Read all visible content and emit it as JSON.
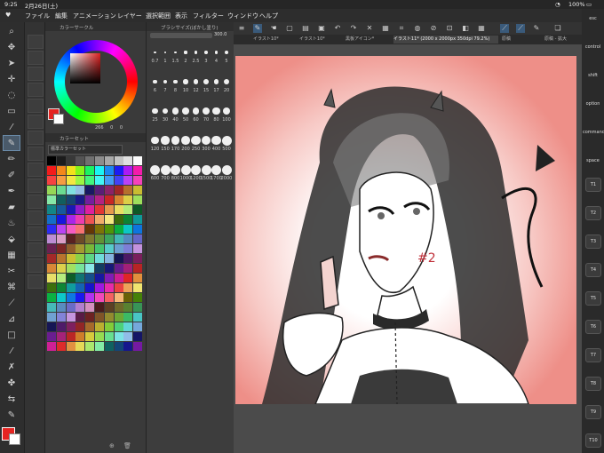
{
  "status": {
    "time": "9:25",
    "date": "2月26日(土)",
    "battery": "100%"
  },
  "menu": [
    "ファイル",
    "編集",
    "アニメーション",
    "レイヤー",
    "選択範囲",
    "表示",
    "フィルター",
    "ウィンドウ",
    "ヘルプ"
  ],
  "panels": {
    "color_circle": "カラーサークル",
    "brush_size": "ブラシサイズ(ぼかし塗り)",
    "brush_value": "300.0",
    "color_set": "カラーセット",
    "color_set_name": "標準カラーセット",
    "hsv": [
      "266",
      "0",
      "0"
    ]
  },
  "brush_sizes": [
    "0.7",
    "1",
    "1.5",
    "2",
    "2.5",
    "3",
    "4",
    "5",
    "6",
    "7",
    "8",
    "10",
    "12",
    "15",
    "17",
    "20",
    "25",
    "30",
    "40",
    "50",
    "60",
    "70",
    "80",
    "100",
    "120",
    "150",
    "170",
    "200",
    "250",
    "300",
    "400",
    "500",
    "600",
    "700",
    "800",
    "1000",
    "1200",
    "1500",
    "1700",
    "2000"
  ],
  "tabs": [
    "イラスト10*",
    "イラスト10*",
    "黒板アイコン*",
    "イラスト11* (2000 x 2000px 350dpi 79.2%)",
    "原稿",
    "原稿 - 拡大"
  ],
  "right_keys": {
    "esc": "esc",
    "control": "control",
    "shift": "shift",
    "option": "option",
    "command": "command",
    "space": "space"
  },
  "tkeys": [
    "T1",
    "T2",
    "T3",
    "T4",
    "T5",
    "T6",
    "T7",
    "T8",
    "T9",
    "T10"
  ],
  "artwork": {
    "annotation": "#2"
  },
  "colors": {
    "fg": "#e52421",
    "accent": "#2c5d8c"
  }
}
